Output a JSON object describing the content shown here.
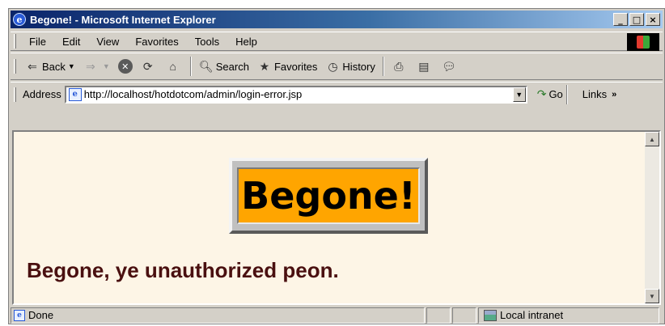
{
  "window": {
    "title": "Begone! - Microsoft Internet Explorer",
    "controls": [
      "_",
      "□",
      "×"
    ]
  },
  "menu": [
    "File",
    "Edit",
    "View",
    "Favorites",
    "Tools",
    "Help"
  ],
  "toolbar": {
    "back": "Back",
    "search": "Search",
    "favorites": "Favorites",
    "history": "History"
  },
  "address": {
    "label": "Address",
    "url": "http://localhost/hotdotcom/admin/login-error.jsp",
    "go": "Go",
    "links": "Links"
  },
  "content": {
    "banner": "Begone!",
    "message": "Begone, ye unauthorized peon."
  },
  "status": {
    "text": "Done",
    "zone": "Local intranet"
  },
  "colors": {
    "banner_bg": "#ffa500",
    "page_bg": "#fdf5e6",
    "message": "#4a1010"
  }
}
